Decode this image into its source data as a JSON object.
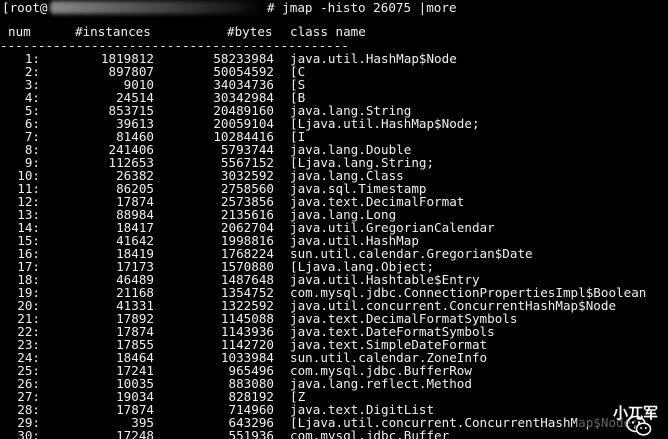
{
  "colors": {
    "background": "#000000",
    "text": "#f0f0f0"
  },
  "prompt": {
    "start": "[root@",
    "command": "# jmap -histo 26075 |more"
  },
  "header": {
    "num": "num",
    "instances": "#instances",
    "bytes": "#bytes",
    "class_name": "class name"
  },
  "divider": "----------------------------------------------",
  "rows": [
    {
      "num": "1:",
      "instances": "1819812",
      "bytes": "58233984",
      "class": "java.util.HashMap$Node"
    },
    {
      "num": "2:",
      "instances": "897807",
      "bytes": "50054592",
      "class": "[C"
    },
    {
      "num": "3:",
      "instances": "9010",
      "bytes": "34034736",
      "class": "[S"
    },
    {
      "num": "4:",
      "instances": "24514",
      "bytes": "30342984",
      "class": "[B"
    },
    {
      "num": "5:",
      "instances": "853715",
      "bytes": "20489160",
      "class": "java.lang.String"
    },
    {
      "num": "6:",
      "instances": "39613",
      "bytes": "20059104",
      "class": "[Ljava.util.HashMap$Node;"
    },
    {
      "num": "7:",
      "instances": "81460",
      "bytes": "10284416",
      "class": "[I"
    },
    {
      "num": "8:",
      "instances": "241406",
      "bytes": "5793744",
      "class": "java.lang.Double"
    },
    {
      "num": "9:",
      "instances": "112653",
      "bytes": "5567152",
      "class": "[Ljava.lang.String;"
    },
    {
      "num": "10:",
      "instances": "26382",
      "bytes": "3032592",
      "class": "java.lang.Class"
    },
    {
      "num": "11:",
      "instances": "86205",
      "bytes": "2758560",
      "class": "java.sql.Timestamp"
    },
    {
      "num": "12:",
      "instances": "17874",
      "bytes": "2573856",
      "class": "java.text.DecimalFormat"
    },
    {
      "num": "13:",
      "instances": "88984",
      "bytes": "2135616",
      "class": "java.lang.Long"
    },
    {
      "num": "14:",
      "instances": "18417",
      "bytes": "2062704",
      "class": "java.util.GregorianCalendar"
    },
    {
      "num": "15:",
      "instances": "41642",
      "bytes": "1998816",
      "class": "java.util.HashMap"
    },
    {
      "num": "16:",
      "instances": "18419",
      "bytes": "1768224",
      "class": "sun.util.calendar.Gregorian$Date"
    },
    {
      "num": "17:",
      "instances": "17173",
      "bytes": "1570880",
      "class": "[Ljava.lang.Object;"
    },
    {
      "num": "18:",
      "instances": "46489",
      "bytes": "1487648",
      "class": "java.util.Hashtable$Entry"
    },
    {
      "num": "19:",
      "instances": "21168",
      "bytes": "1354752",
      "class": "com.mysql.jdbc.ConnectionPropertiesImpl$Boolean"
    },
    {
      "num": "20:",
      "instances": "41331",
      "bytes": "1322592",
      "class": "java.util.concurrent.ConcurrentHashMap$Node"
    },
    {
      "num": "21:",
      "instances": "17892",
      "bytes": "1145088",
      "class": "java.text.DecimalFormatSymbols"
    },
    {
      "num": "22:",
      "instances": "17874",
      "bytes": "1143936",
      "class": "java.text.DateFormatSymbols"
    },
    {
      "num": "23:",
      "instances": "17855",
      "bytes": "1142720",
      "class": "java.text.SimpleDateFormat"
    },
    {
      "num": "24:",
      "instances": "18464",
      "bytes": "1033984",
      "class": "sun.util.calendar.ZoneInfo"
    },
    {
      "num": "25:",
      "instances": "17241",
      "bytes": "965496",
      "class": "com.mysql.jdbc.BufferRow"
    },
    {
      "num": "26:",
      "instances": "10035",
      "bytes": "883080",
      "class": "java.lang.reflect.Method"
    },
    {
      "num": "27:",
      "instances": "19034",
      "bytes": "828192",
      "class": "[Z"
    },
    {
      "num": "28:",
      "instances": "17874",
      "bytes": "714960",
      "class": "java.text.DigitList"
    },
    {
      "num": "29:",
      "instances": "395",
      "bytes": "643296",
      "class": "[Ljava.util.concurrent.ConcurrentHashMap$Node;"
    },
    {
      "num": "30:",
      "instances": "17248",
      "bytes": "551936",
      "class": "com.mysql.jdbc.Buffer"
    }
  ],
  "watermark": {
    "text": "小兀军",
    "icon": "wechat-icon"
  }
}
